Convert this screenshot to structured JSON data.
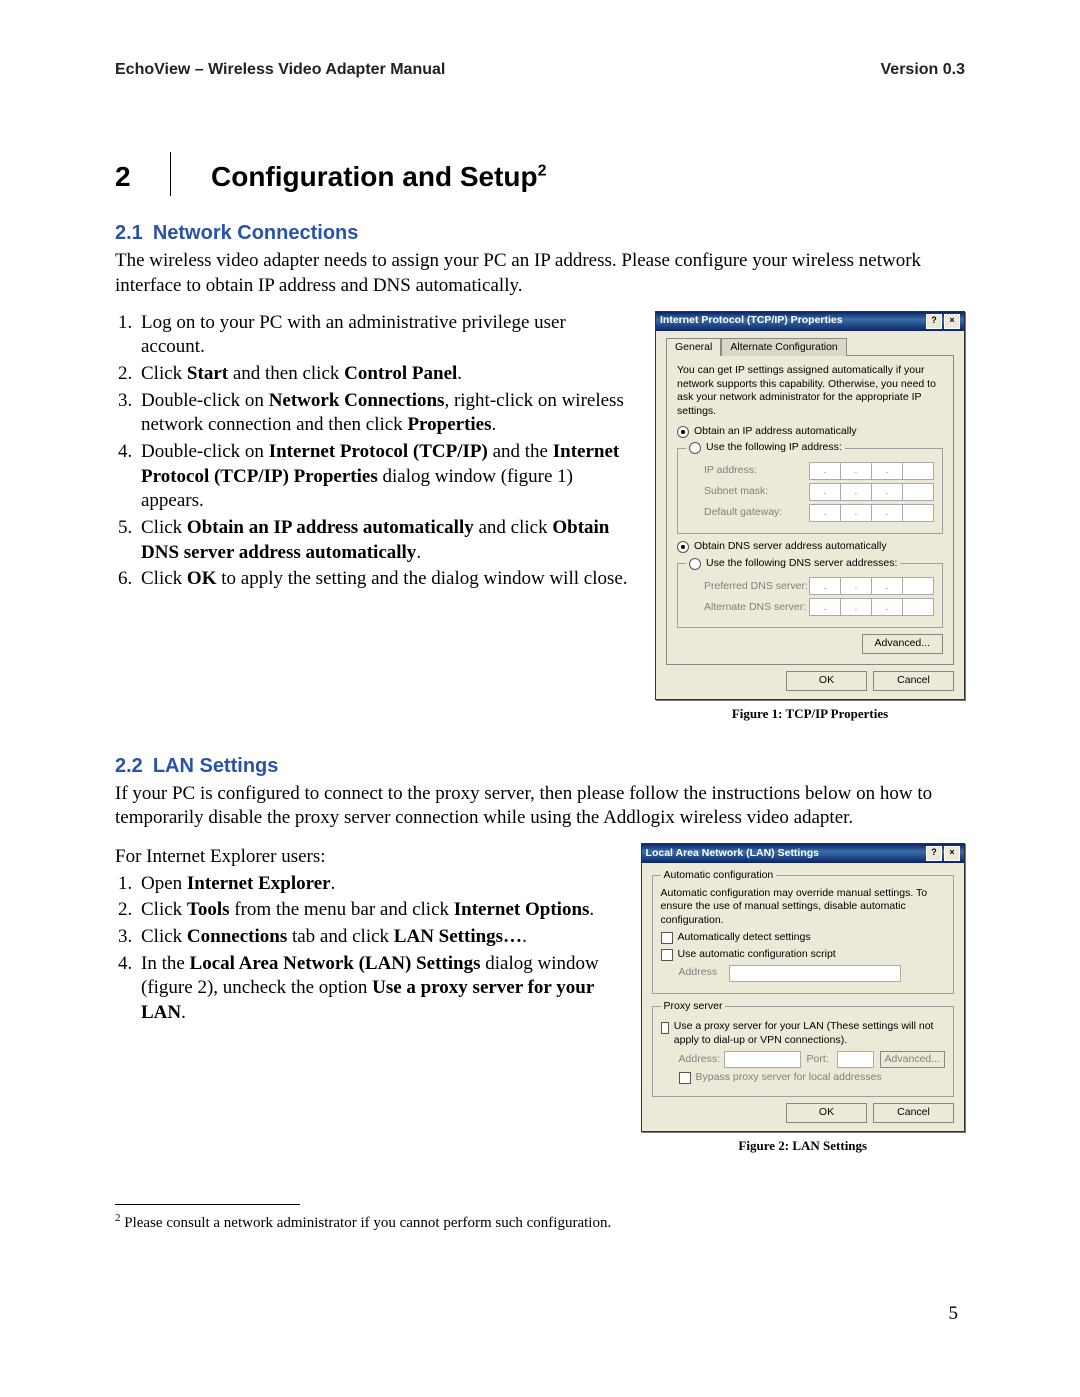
{
  "header": {
    "left": "EchoView – Wireless Video Adapter Manual",
    "right": "Version 0.3"
  },
  "chapter": {
    "number": "2",
    "title": "Configuration and Setup",
    "footnote_mark": "2"
  },
  "section_21": {
    "num": "2.1",
    "title": "Network Connections",
    "intro": "The wireless video adapter needs to assign your PC an IP address.  Please configure your wireless network interface to obtain IP address and DNS automatically.",
    "steps": {
      "s1": "Log on to your PC with an administrative privilege user account.",
      "s2a": "Click ",
      "s2b": "Start",
      "s2c": " and then click ",
      "s2d": "Control Panel",
      "s2e": ".",
      "s3a": "Double-click on ",
      "s3b": "Network Connections",
      "s3c": ", right-click on wireless network connection and then click ",
      "s3d": "Properties",
      "s3e": ".",
      "s4a": "Double-click on ",
      "s4b": "Internet Protocol (TCP/IP)",
      "s4c": " and the ",
      "s4d": "Internet Protocol (TCP/IP) Properties",
      "s4e": " dialog window (figure 1) appears.",
      "s5a": "Click ",
      "s5b": "Obtain an IP address automatically",
      "s5c": " and click ",
      "s5d": "Obtain DNS server address automatically",
      "s5e": ".",
      "s6a": "Click ",
      "s6b": "OK",
      "s6c": " to apply the setting and the dialog window will close."
    },
    "figure_caption": "Figure 1: TCP/IP Properties"
  },
  "dialog1": {
    "title": "Internet Protocol (TCP/IP) Properties",
    "tab_general": "General",
    "tab_alt": "Alternate Configuration",
    "blurb": "You can get IP settings assigned automatically if your network supports this capability. Otherwise, you need to ask your network administrator for the appropriate IP settings.",
    "radio_obtain_ip": "Obtain an IP address automatically",
    "radio_use_ip": "Use the following IP address:",
    "ip_label": "IP address:",
    "subnet_label": "Subnet mask:",
    "gateway_label": "Default gateway:",
    "radio_obtain_dns": "Obtain DNS server address automatically",
    "radio_use_dns": "Use the following DNS server addresses:",
    "pref_dns": "Preferred DNS server:",
    "alt_dns": "Alternate DNS server:",
    "advanced": "Advanced...",
    "ok": "OK",
    "cancel": "Cancel"
  },
  "section_22": {
    "num": "2.2",
    "title": "LAN Settings",
    "intro": "If your PC is configured to connect to the proxy server, then please follow the instructions below on how to temporarily disable the proxy server connection while using the Addlogix wireless video adapter.",
    "ie_line": "For Internet Explorer users:",
    "steps": {
      "s1a": "Open ",
      "s1b": "Internet Explorer",
      "s1c": ".",
      "s2a": "Click ",
      "s2b": "Tools",
      "s2c": " from the menu bar and click ",
      "s2d": "Internet Options",
      "s2e": ".",
      "s3a": "Click ",
      "s3b": "Connections",
      "s3c": " tab and click ",
      "s3d": "LAN Settings…",
      "s3e": ".",
      "s4a": "In the ",
      "s4b": "Local Area Network (LAN) Settings",
      "s4c": " dialog window (figure 2), uncheck the option ",
      "s4d": "Use a proxy server for your LAN",
      "s4e": "."
    },
    "figure_caption": "Figure 2: LAN Settings"
  },
  "dialog2": {
    "title": "Local Area Network (LAN) Settings",
    "grp_auto": "Automatic configuration",
    "auto_blurb": "Automatic configuration may override manual settings.  To ensure the use of manual settings, disable automatic configuration.",
    "chk_auto_detect": "Automatically detect settings",
    "chk_auto_script": "Use automatic configuration script",
    "address_label": "Address",
    "grp_proxy": "Proxy server",
    "chk_proxy": "Use a proxy server for your LAN (These settings will not apply to dial-up or VPN connections).",
    "address2": "Address:",
    "port": "Port:",
    "adv": "Advanced...",
    "bypass": "Bypass proxy server for local addresses",
    "ok": "OK",
    "cancel": "Cancel"
  },
  "footnote": {
    "mark": "2",
    "text": " Please consult a network administrator if you cannot perform such configuration."
  },
  "page_number": "5"
}
